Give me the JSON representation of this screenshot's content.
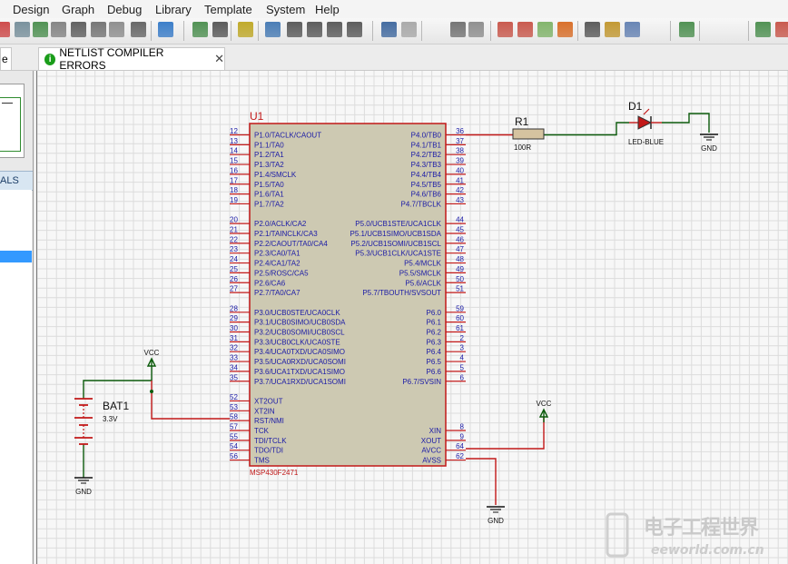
{
  "menu": [
    "Design",
    "Graph",
    "Debug",
    "Library",
    "Template",
    "System",
    "Help"
  ],
  "tabs": {
    "left_partial": "e",
    "netlist": {
      "label": "NETLIST COMPILER ERRORS",
      "close": "✕"
    }
  },
  "left_panel": {
    "header": "ALS"
  },
  "schematic": {
    "u1": {
      "ref": "U1",
      "part": "MSP430F2471",
      "left_pins": [
        {
          "num": "12",
          "name": "P1.0/TACLK/CAOUT"
        },
        {
          "num": "13",
          "name": "P1.1/TA0"
        },
        {
          "num": "14",
          "name": "P1.2/TA1"
        },
        {
          "num": "15",
          "name": "P1.3/TA2"
        },
        {
          "num": "16",
          "name": "P1.4/SMCLK"
        },
        {
          "num": "17",
          "name": "P1.5/TA0"
        },
        {
          "num": "18",
          "name": "P1.6/TA1"
        },
        {
          "num": "19",
          "name": "P1.7/TA2"
        },
        {
          "num": "20",
          "name": "P2.0/ACLK/CA2"
        },
        {
          "num": "21",
          "name": "P2.1/TAINCLK/CA3"
        },
        {
          "num": "22",
          "name": "P2.2/CAOUT/TA0/CA4"
        },
        {
          "num": "23",
          "name": "P2.3/CA0/TA1"
        },
        {
          "num": "24",
          "name": "P2.4/CA1/TA2"
        },
        {
          "num": "25",
          "name": "P2.5/ROSC/CA5"
        },
        {
          "num": "26",
          "name": "P2.6/CA6"
        },
        {
          "num": "27",
          "name": "P2.7/TA0/CA7"
        },
        {
          "num": "28",
          "name": "P3.0/UCB0STE/UCA0CLK"
        },
        {
          "num": "29",
          "name": "P3.1/UCB0SIMO/UCB0SDA"
        },
        {
          "num": "30",
          "name": "P3.2/UCB0SOMI/UCB0SCL"
        },
        {
          "num": "31",
          "name": "P3.3/UCB0CLK/UCA0STE"
        },
        {
          "num": "32",
          "name": "P3.4/UCA0TXD/UCA0SIMO"
        },
        {
          "num": "33",
          "name": "P3.5/UCA0RXD/UCA0SOMI"
        },
        {
          "num": "34",
          "name": "P3.6/UCA1TXD/UCA1SIMO"
        },
        {
          "num": "35",
          "name": "P3.7/UCA1RXD/UCA1SOMI"
        },
        {
          "num": "52",
          "name": "XT2OUT"
        },
        {
          "num": "53",
          "name": "XT2IN"
        },
        {
          "num": "58",
          "name": "RST/NMI"
        },
        {
          "num": "57",
          "name": "TCK"
        },
        {
          "num": "55",
          "name": "TDI/TCLK"
        },
        {
          "num": "54",
          "name": "TDO/TDI"
        },
        {
          "num": "56",
          "name": "TMS"
        }
      ],
      "right_pins": [
        {
          "num": "36",
          "name": "P4.0/TB0"
        },
        {
          "num": "37",
          "name": "P4.1/TB1"
        },
        {
          "num": "38",
          "name": "P4.2/TB2"
        },
        {
          "num": "39",
          "name": "P4.3/TB3"
        },
        {
          "num": "40",
          "name": "P4.4/TB4"
        },
        {
          "num": "41",
          "name": "P4.5/TB5"
        },
        {
          "num": "42",
          "name": "P4.6/TB6"
        },
        {
          "num": "43",
          "name": "P4.7/TBCLK"
        },
        {
          "num": "44",
          "name": "P5.0/UCB1STE/UCA1CLK"
        },
        {
          "num": "45",
          "name": "P5.1/UCB1SIMO/UCB1SDA"
        },
        {
          "num": "46",
          "name": "P5.2/UCB1SOMI/UCB1SCL"
        },
        {
          "num": "47",
          "name": "P5.3/UCB1CLK/UCA1STE"
        },
        {
          "num": "48",
          "name": "P5.4/MCLK"
        },
        {
          "num": "49",
          "name": "P5.5/SMCLK"
        },
        {
          "num": "50",
          "name": "P5.6/ACLK"
        },
        {
          "num": "51",
          "name": "P5.7/TBOUTH/SVSOUT"
        },
        {
          "num": "59",
          "name": "P6.0"
        },
        {
          "num": "60",
          "name": "P6.1"
        },
        {
          "num": "61",
          "name": "P6.2"
        },
        {
          "num": "2",
          "name": "P6.3"
        },
        {
          "num": "3",
          "name": "P6.4"
        },
        {
          "num": "4",
          "name": "P6.5"
        },
        {
          "num": "5",
          "name": "P6.6"
        },
        {
          "num": "6",
          "name": "P6.7/SVSIN"
        },
        {
          "num": "8",
          "name": "XIN"
        },
        {
          "num": "9",
          "name": "XOUT"
        },
        {
          "num": "64",
          "name": "AVCC"
        },
        {
          "num": "62",
          "name": "AVSS"
        }
      ]
    },
    "r1": {
      "ref": "R1",
      "value": "100R"
    },
    "d1": {
      "ref": "D1",
      "value": "LED-BLUE"
    },
    "bat1": {
      "ref": "BAT1",
      "value": "3.3V"
    },
    "vcc_label": "VCC",
    "gnd_label": "GND"
  },
  "watermark": {
    "cn": "电子工程世界",
    "en": "eeworld.com.cn"
  },
  "colors": {
    "wire": "#0b5a0b",
    "part": "#c21818",
    "chip_fill": "#cdc9b2",
    "grid": "#dcdcdc",
    "led": "#c21818",
    "pin_text": "#1a1aa6"
  }
}
